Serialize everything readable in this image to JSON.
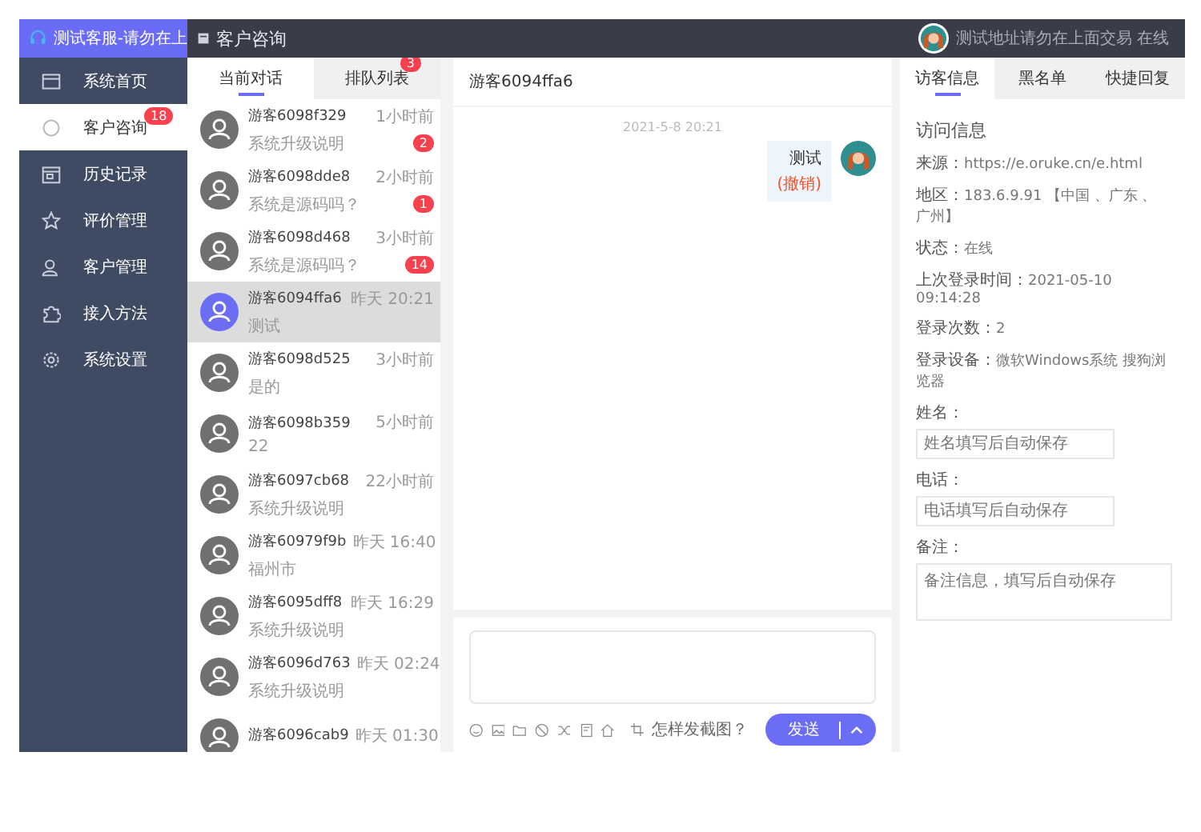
{
  "brand": {
    "title": "测试客服-请勿在上"
  },
  "header": {
    "title": "客户咨询",
    "agent_status": "测试地址请勿在上面交易 在线"
  },
  "sidebar": {
    "items": [
      {
        "label": "系统首页",
        "selected": false
      },
      {
        "label": "客户咨询",
        "selected": true,
        "badge": "18"
      },
      {
        "label": "历史记录",
        "selected": false
      },
      {
        "label": "评价管理",
        "selected": false
      },
      {
        "label": "客户管理",
        "selected": false
      },
      {
        "label": "接入方法",
        "selected": false
      },
      {
        "label": "系统设置",
        "selected": false
      }
    ]
  },
  "list_tabs": [
    {
      "label": "当前对话",
      "selected": true
    },
    {
      "label": "排队列表",
      "selected": false,
      "badge": "3"
    }
  ],
  "conversations": [
    {
      "name": "游客6098f329",
      "time": "1小时前",
      "preview": "系统升级说明",
      "badge": "2",
      "selected": false
    },
    {
      "name": "游客6098dde8",
      "time": "2小时前",
      "preview": "系统是源码吗？",
      "badge": "1",
      "selected": false
    },
    {
      "name": "游客6098d468",
      "time": "3小时前",
      "preview": "系统是源码吗？",
      "badge": "14",
      "selected": false
    },
    {
      "name": "游客6094ffa6",
      "time": "昨天 20:21",
      "preview": "测试",
      "selected": true
    },
    {
      "name": "游客6098d525",
      "time": "3小时前",
      "preview": "是的",
      "selected": false
    },
    {
      "name": "游客6098b359",
      "time": "5小时前",
      "preview": "22",
      "selected": false
    },
    {
      "name": "游客6097cb68",
      "time": "22小时前",
      "preview": "系统升级说明",
      "selected": false
    },
    {
      "name": "游客60979f9b",
      "time": "昨天 16:40",
      "preview": "福州市",
      "selected": false
    },
    {
      "name": "游客6095dff8",
      "time": "昨天 16:29",
      "preview": "系统升级说明",
      "selected": false
    },
    {
      "name": "游客6096d763",
      "time": "昨天 02:24",
      "preview": "系统升级说明",
      "selected": false
    },
    {
      "name": "游客6096cab9",
      "time": "昨天 01:30",
      "selected": false
    }
  ],
  "chat": {
    "title": "游客6094ffa6",
    "timestamp": "2021-5-8 20:21",
    "messages": [
      {
        "text": "测试",
        "recall": "(撤销)"
      }
    ],
    "screenshot_hint": "怎样发截图？",
    "send_button": "发送"
  },
  "right_tabs": [
    {
      "label": "访客信息",
      "selected": true
    },
    {
      "label": "黑名单",
      "selected": false
    },
    {
      "label": "快捷回复",
      "selected": false
    }
  ],
  "visitor": {
    "heading": "访问信息",
    "info": [
      {
        "label": "来源：",
        "value": "https://e.oruke.cn/e.html"
      },
      {
        "label": "地区：",
        "value": "183.6.9.91 【中国 、广东 、广州】"
      },
      {
        "label": "状态：",
        "value": "在线"
      },
      {
        "label": "上次登录时间：",
        "value": "2021-05-10 09:14:28"
      },
      {
        "label": "登录次数：",
        "value": "2"
      },
      {
        "label": "登录设备：",
        "value": "微软Windows系统 搜狗浏览器"
      }
    ],
    "fields": [
      {
        "kind": "input",
        "label": "姓名：",
        "placeholder": "姓名填写后自动保存"
      },
      {
        "kind": "input",
        "label": "电话：",
        "placeholder": "电话填写后自动保存"
      },
      {
        "kind": "textarea",
        "label": "备注：",
        "placeholder": "备注信息，填写后自动保存"
      }
    ]
  }
}
